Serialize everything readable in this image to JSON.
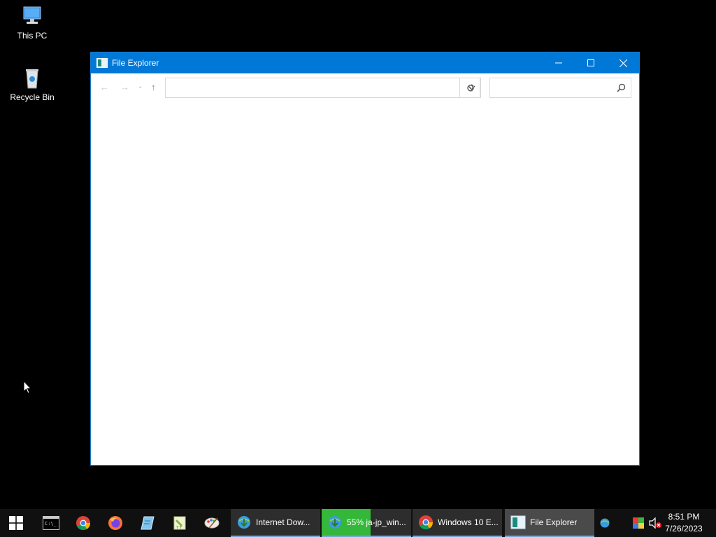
{
  "desktop": {
    "icons": [
      {
        "label": "This PC"
      },
      {
        "label": "Recycle Bin"
      }
    ]
  },
  "window": {
    "title": "File Explorer",
    "address_value": "",
    "search_value": "",
    "colors": {
      "titlebar": "#0078d7",
      "border": "#1979ca"
    }
  },
  "taskbar": {
    "pinned": [
      "windows-start",
      "terminal",
      "chrome",
      "firefox",
      "notepad",
      "notepadpp",
      "paint"
    ],
    "apps": [
      {
        "label": "Internet Dow..."
      },
      {
        "label": "55% ja-jp_win...",
        "progress_percent": 55
      },
      {
        "label": "Windows 10 E..."
      },
      {
        "label": "File Explorer",
        "active": true
      }
    ],
    "clock": {
      "time": "8:51 PM",
      "date": "7/26/2023"
    }
  }
}
